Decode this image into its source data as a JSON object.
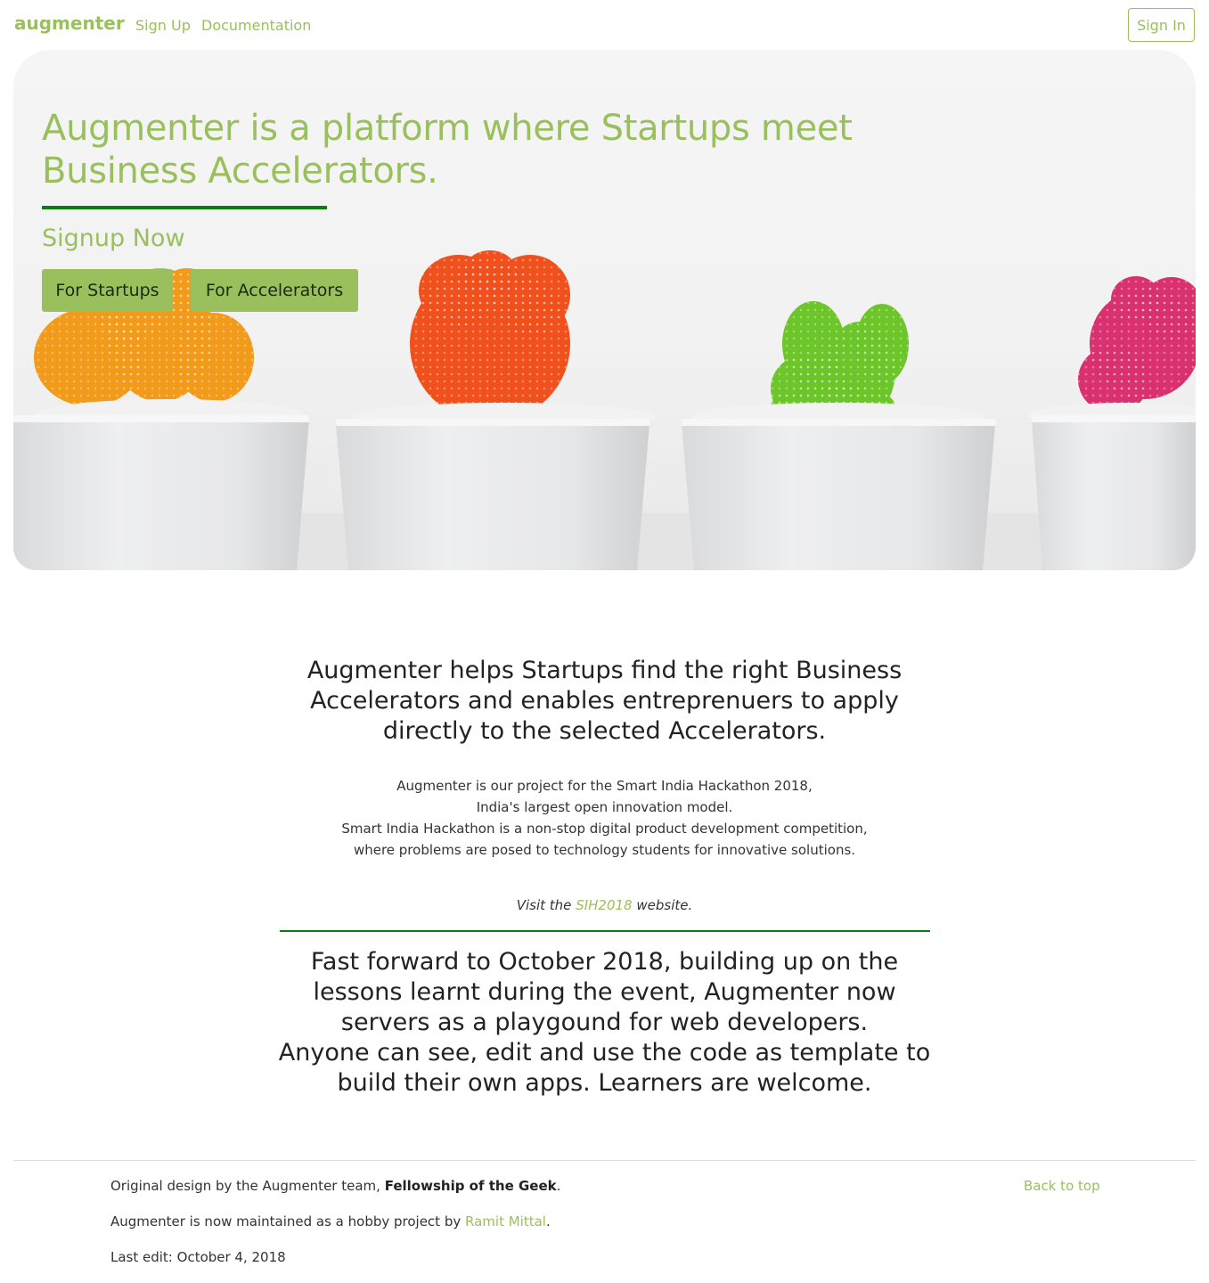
{
  "nav": {
    "brand": "augmenter",
    "links": [
      "Sign Up",
      "Documentation"
    ],
    "signin_label": "Sign In"
  },
  "hero": {
    "title": "Augmenter is a platform where Startups meet Business Accelerators.",
    "signup_heading": "Signup Now",
    "buttons": [
      "For Startups",
      "For Accelerators"
    ],
    "cactus_colors": [
      "#f29a1a",
      "#f0501c",
      "#6cc62a",
      "#d93070"
    ]
  },
  "content": {
    "lead": "Augmenter helps Startups find the right Business Accelerators and enables entreprenuers to apply directly to the selected Accelerators.",
    "info_lines": [
      "Augmenter is our project for the Smart India Hackathon 2018,",
      "India's largest open innovation model.",
      "Smart India Hackathon is a non-stop digital product development competition,",
      "where problems are posed to technology students for innovative solutions."
    ],
    "visit_prefix": "Visit the",
    "visit_link": "SIH2018",
    "visit_suffix": "website.",
    "lead2_line1": "Fast forward to October 2018, building up on the lessons learnt during the event, Augmenter now servers as a playgound for web developers.",
    "lead2_line2": "Anyone can see, edit and use the code as template to build their own apps. Learners are welcome."
  },
  "footer": {
    "design_prefix": "Original design by the Augmenter team,",
    "design_team": "Fellowship of the Geek",
    "design_suffix": ".",
    "maintained_prefix": "Augmenter is now maintained as a hobby project by",
    "maintainer": "Ramit Mittal",
    "maintained_suffix": ".",
    "last_edit": "Last edit: October 4, 2018",
    "back_to_top": "Back to top"
  },
  "colors": {
    "accent": "#99c05c",
    "rule": "#0b7d0b"
  }
}
